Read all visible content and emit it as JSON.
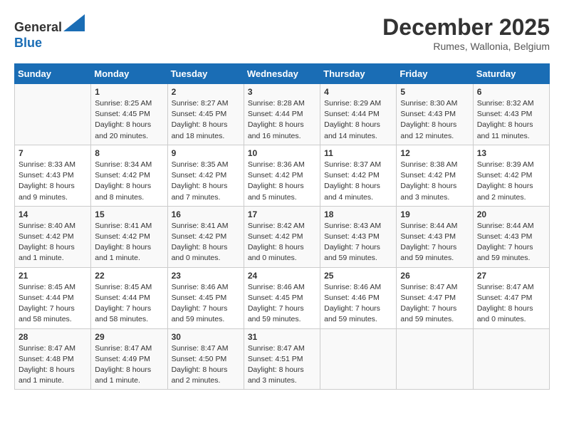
{
  "header": {
    "logo_line1": "General",
    "logo_line2": "Blue",
    "month_title": "December 2025",
    "subtitle": "Rumes, Wallonia, Belgium"
  },
  "days_of_week": [
    "Sunday",
    "Monday",
    "Tuesday",
    "Wednesday",
    "Thursday",
    "Friday",
    "Saturday"
  ],
  "weeks": [
    [
      {
        "day": "",
        "info": ""
      },
      {
        "day": "1",
        "info": "Sunrise: 8:25 AM\nSunset: 4:45 PM\nDaylight: 8 hours\nand 20 minutes."
      },
      {
        "day": "2",
        "info": "Sunrise: 8:27 AM\nSunset: 4:45 PM\nDaylight: 8 hours\nand 18 minutes."
      },
      {
        "day": "3",
        "info": "Sunrise: 8:28 AM\nSunset: 4:44 PM\nDaylight: 8 hours\nand 16 minutes."
      },
      {
        "day": "4",
        "info": "Sunrise: 8:29 AM\nSunset: 4:44 PM\nDaylight: 8 hours\nand 14 minutes."
      },
      {
        "day": "5",
        "info": "Sunrise: 8:30 AM\nSunset: 4:43 PM\nDaylight: 8 hours\nand 12 minutes."
      },
      {
        "day": "6",
        "info": "Sunrise: 8:32 AM\nSunset: 4:43 PM\nDaylight: 8 hours\nand 11 minutes."
      }
    ],
    [
      {
        "day": "7",
        "info": "Sunrise: 8:33 AM\nSunset: 4:43 PM\nDaylight: 8 hours\nand 9 minutes."
      },
      {
        "day": "8",
        "info": "Sunrise: 8:34 AM\nSunset: 4:42 PM\nDaylight: 8 hours\nand 8 minutes."
      },
      {
        "day": "9",
        "info": "Sunrise: 8:35 AM\nSunset: 4:42 PM\nDaylight: 8 hours\nand 7 minutes."
      },
      {
        "day": "10",
        "info": "Sunrise: 8:36 AM\nSunset: 4:42 PM\nDaylight: 8 hours\nand 5 minutes."
      },
      {
        "day": "11",
        "info": "Sunrise: 8:37 AM\nSunset: 4:42 PM\nDaylight: 8 hours\nand 4 minutes."
      },
      {
        "day": "12",
        "info": "Sunrise: 8:38 AM\nSunset: 4:42 PM\nDaylight: 8 hours\nand 3 minutes."
      },
      {
        "day": "13",
        "info": "Sunrise: 8:39 AM\nSunset: 4:42 PM\nDaylight: 8 hours\nand 2 minutes."
      }
    ],
    [
      {
        "day": "14",
        "info": "Sunrise: 8:40 AM\nSunset: 4:42 PM\nDaylight: 8 hours\nand 1 minute."
      },
      {
        "day": "15",
        "info": "Sunrise: 8:41 AM\nSunset: 4:42 PM\nDaylight: 8 hours\nand 1 minute."
      },
      {
        "day": "16",
        "info": "Sunrise: 8:41 AM\nSunset: 4:42 PM\nDaylight: 8 hours\nand 0 minutes."
      },
      {
        "day": "17",
        "info": "Sunrise: 8:42 AM\nSunset: 4:42 PM\nDaylight: 8 hours\nand 0 minutes."
      },
      {
        "day": "18",
        "info": "Sunrise: 8:43 AM\nSunset: 4:43 PM\nDaylight: 7 hours\nand 59 minutes."
      },
      {
        "day": "19",
        "info": "Sunrise: 8:44 AM\nSunset: 4:43 PM\nDaylight: 7 hours\nand 59 minutes."
      },
      {
        "day": "20",
        "info": "Sunrise: 8:44 AM\nSunset: 4:43 PM\nDaylight: 7 hours\nand 59 minutes."
      }
    ],
    [
      {
        "day": "21",
        "info": "Sunrise: 8:45 AM\nSunset: 4:44 PM\nDaylight: 7 hours\nand 58 minutes."
      },
      {
        "day": "22",
        "info": "Sunrise: 8:45 AM\nSunset: 4:44 PM\nDaylight: 7 hours\nand 58 minutes."
      },
      {
        "day": "23",
        "info": "Sunrise: 8:46 AM\nSunset: 4:45 PM\nDaylight: 7 hours\nand 59 minutes."
      },
      {
        "day": "24",
        "info": "Sunrise: 8:46 AM\nSunset: 4:45 PM\nDaylight: 7 hours\nand 59 minutes."
      },
      {
        "day": "25",
        "info": "Sunrise: 8:46 AM\nSunset: 4:46 PM\nDaylight: 7 hours\nand 59 minutes."
      },
      {
        "day": "26",
        "info": "Sunrise: 8:47 AM\nSunset: 4:47 PM\nDaylight: 7 hours\nand 59 minutes."
      },
      {
        "day": "27",
        "info": "Sunrise: 8:47 AM\nSunset: 4:47 PM\nDaylight: 8 hours\nand 0 minutes."
      }
    ],
    [
      {
        "day": "28",
        "info": "Sunrise: 8:47 AM\nSunset: 4:48 PM\nDaylight: 8 hours\nand 1 minute."
      },
      {
        "day": "29",
        "info": "Sunrise: 8:47 AM\nSunset: 4:49 PM\nDaylight: 8 hours\nand 1 minute."
      },
      {
        "day": "30",
        "info": "Sunrise: 8:47 AM\nSunset: 4:50 PM\nDaylight: 8 hours\nand 2 minutes."
      },
      {
        "day": "31",
        "info": "Sunrise: 8:47 AM\nSunset: 4:51 PM\nDaylight: 8 hours\nand 3 minutes."
      },
      {
        "day": "",
        "info": ""
      },
      {
        "day": "",
        "info": ""
      },
      {
        "day": "",
        "info": ""
      }
    ]
  ]
}
